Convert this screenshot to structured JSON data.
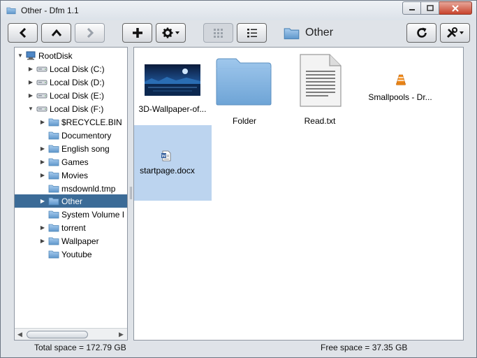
{
  "window": {
    "title": "Other - Dfm 1.1"
  },
  "toolbar": {
    "current_path": "Other"
  },
  "tree": {
    "root": "RootDisk",
    "items": [
      {
        "label": "Local Disk (C:)"
      },
      {
        "label": "Local Disk (D:)"
      },
      {
        "label": "Local Disk (E:)"
      },
      {
        "label": "Local Disk (F:)"
      },
      {
        "label": "$RECYCLE.BIN"
      },
      {
        "label": "Documentory"
      },
      {
        "label": "English song"
      },
      {
        "label": "Games"
      },
      {
        "label": "Movies"
      },
      {
        "label": "msdownld.tmp"
      },
      {
        "label": "Other"
      },
      {
        "label": "System Volume I"
      },
      {
        "label": "torrent"
      },
      {
        "label": "Wallpaper"
      },
      {
        "label": "Youtube"
      }
    ]
  },
  "files": [
    {
      "name": "3D-Wallpaper-of..."
    },
    {
      "name": "Folder"
    },
    {
      "name": "Read.txt"
    },
    {
      "name": "Smallpools - Dr..."
    },
    {
      "name": "startpage.docx"
    }
  ],
  "status": {
    "total": "Total space =  172.79 GB",
    "free": "Free space =  37.35 GB"
  },
  "colors": {
    "selection_tree": "#3b6b97",
    "selection_file": "#bcd4ef",
    "folder_blue": "#74a7d6"
  }
}
